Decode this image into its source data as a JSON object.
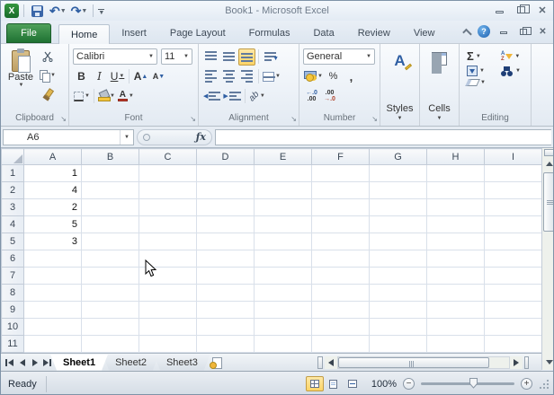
{
  "titlebar": {
    "title": "Book1 - Microsoft Excel"
  },
  "ribbon_tabs": {
    "file": "File",
    "items": [
      "Home",
      "Insert",
      "Page Layout",
      "Formulas",
      "Data",
      "Review",
      "View"
    ],
    "active": "Home"
  },
  "ribbon": {
    "clipboard": {
      "label": "Clipboard",
      "paste_label": "Paste"
    },
    "font": {
      "label": "Font",
      "name": "Calibri",
      "size": "11",
      "bold": "B",
      "italic": "I",
      "underline": "U",
      "grow": "A",
      "shrink": "A",
      "color": "A"
    },
    "alignment": {
      "label": "Alignment",
      "orientation": "ab"
    },
    "number": {
      "label": "Number",
      "format": "General",
      "percent": "%",
      "comma": ",",
      "inc_top": "←.0",
      "inc_bottom": ".00",
      "dec_top": ".00",
      "dec_bottom": "→.0"
    },
    "styles": {
      "label": "Styles"
    },
    "cells": {
      "label": "Cells"
    },
    "editing": {
      "label": "Editing",
      "autosum": "Σ",
      "sort_a": "A",
      "sort_z": "Z"
    }
  },
  "formula_bar": {
    "name_box": "A6",
    "fx": "ƒx",
    "content": ""
  },
  "grid": {
    "columns": [
      "A",
      "B",
      "C",
      "D",
      "E",
      "F",
      "G",
      "H",
      "I"
    ],
    "row_count": 11,
    "active_cell": "A6",
    "cells": [
      {
        "ref": "A1",
        "value": "1"
      },
      {
        "ref": "A2",
        "value": "4"
      },
      {
        "ref": "A3",
        "value": "2"
      },
      {
        "ref": "A4",
        "value": "5"
      },
      {
        "ref": "A5",
        "value": "3"
      }
    ]
  },
  "sheet_bar": {
    "tabs": [
      "Sheet1",
      "Sheet2",
      "Sheet3"
    ],
    "active": "Sheet1"
  },
  "status_bar": {
    "mode": "Ready",
    "zoom_level": "100%"
  },
  "window_controls": {
    "help": "?"
  }
}
